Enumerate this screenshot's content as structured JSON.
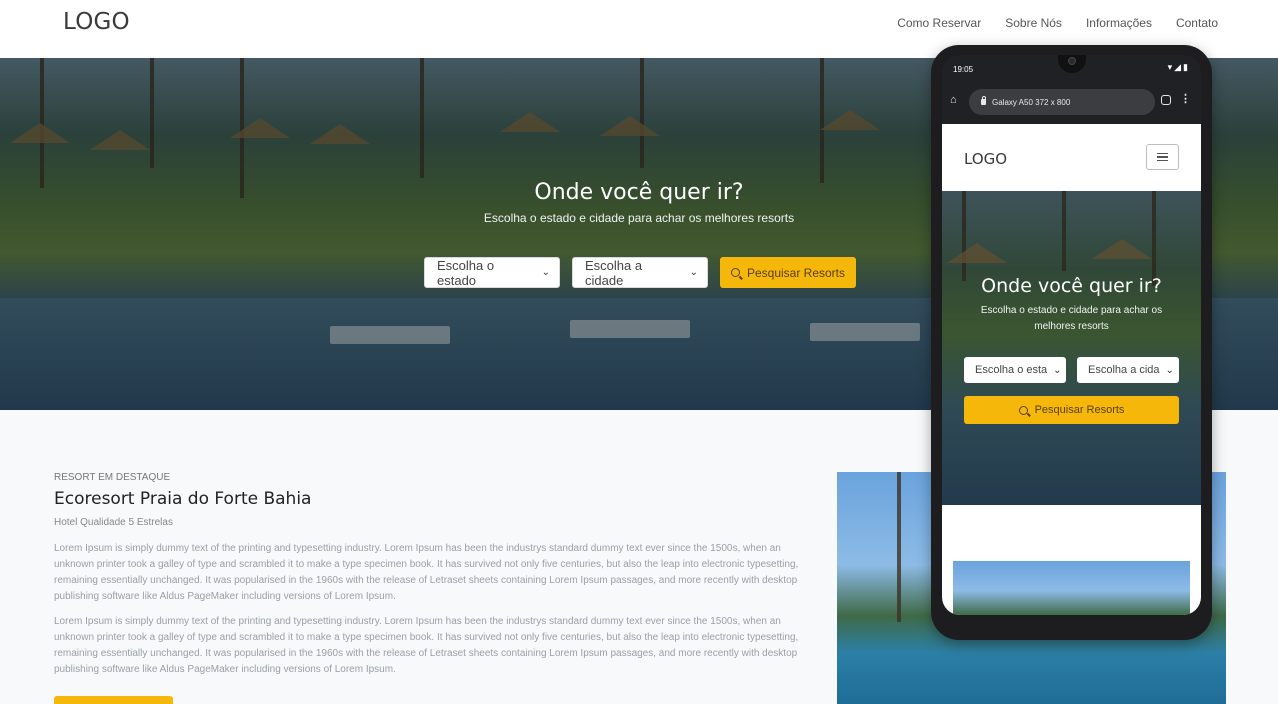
{
  "header": {
    "logo": "LOGO",
    "nav": [
      "Como Reservar",
      "Sobre Nós",
      "Informações",
      "Contato"
    ]
  },
  "hero": {
    "title": "Onde você quer ir?",
    "subtitle": "Escolha o estado e cidade para achar os melhores resorts",
    "state_select": "Escolha o estado",
    "city_select": "Escolha a cidade",
    "search_button": "Pesquisar Resorts"
  },
  "featured": {
    "kicker": "RESORT EM DESTAQUE",
    "title": "Ecoresort Praia do Forte Bahia",
    "rating": "Hotel Qualidade 5 Estrelas",
    "paragraphs": [
      "Lorem Ipsum is simply dummy text of the printing and typesetting industry. Lorem Ipsum has been the industrys standard dummy text ever since the 1500s, when an unknown printer took a galley of type and scrambled it to make a type specimen book. It has survived not only five centuries, but also the leap into electronic typesetting, remaining essentially unchanged. It was popularised in the 1960s with the release of Letraset sheets containing Lorem Ipsum passages, and more recently with desktop publishing software like Aldus PageMaker including versions of Lorem Ipsum.",
      "Lorem Ipsum is simply dummy text of the printing and typesetting industry. Lorem Ipsum has been the industrys standard dummy text ever since the 1500s, when an unknown printer took a galley of type and scrambled it to make a type specimen book. It has survived not only five centuries, but also the leap into electronic typesetting, remaining essentially unchanged. It was popularised in the 1960s with the release of Letraset sheets containing Lorem Ipsum passages, and more recently with desktop publishing software like Aldus PageMaker including versions of Lorem Ipsum."
    ]
  },
  "phone": {
    "time": "19:05",
    "status_icons": "▾◢▮",
    "device_label": "Galaxy A50  372 x 800",
    "logo": "LOGO",
    "hero_title": "Onde você quer ir?",
    "hero_subtitle": "Escolha o estado e cidade para achar os melhores resorts",
    "state_select": "Escolha o esta",
    "city_select": "Escolha a cida",
    "search_button": "Pesquisar Resorts"
  },
  "colors": {
    "accent": "#f5b80a",
    "background": "#f7f9fb",
    "text_muted": "#9aa0a6"
  },
  "icons": [
    "search-icon",
    "chevron-down-icon",
    "home-icon",
    "lock-icon",
    "tabs-icon",
    "more-vert-icon",
    "hamburger-icon",
    "wifi-icon",
    "signal-icon",
    "battery-icon"
  ]
}
